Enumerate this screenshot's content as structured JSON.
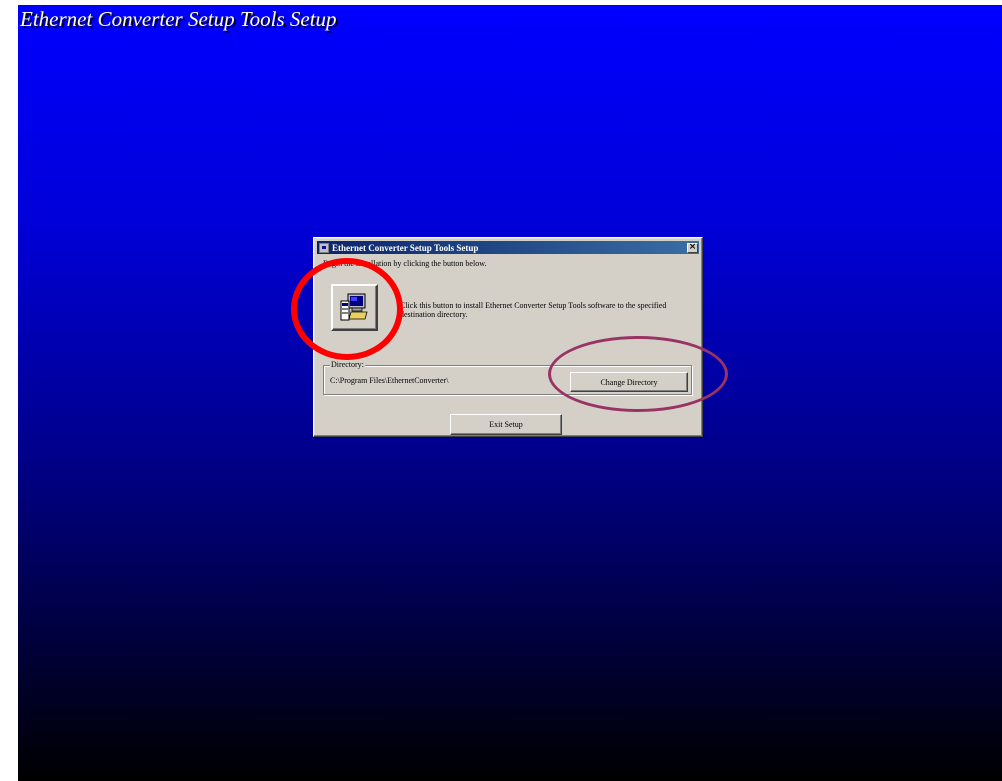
{
  "banner": {
    "title": "Ethernet Converter Setup Tools Setup"
  },
  "dialog": {
    "title": "Ethernet Converter Setup Tools Setup",
    "close_label": "×",
    "instruction": "Begin the installation by clicking the button below.",
    "install_button_icon": "computer-install-icon",
    "install_description": "Click this button to install Ethernet Converter Setup Tools software to the specified destination directory.",
    "directory_group_label": "Directory:",
    "directory_path": "C:\\Program Files\\EthernetConverter\\",
    "change_directory_label": "Change Directory",
    "exit_label": "Exit Setup"
  },
  "annotations": {
    "install_highlight_color": "#ff0000",
    "change_directory_highlight_color": "#993366"
  },
  "colors": {
    "gradient_top": "#0000ff",
    "gradient_bottom": "#000000",
    "dialog_face": "#d4d0c8",
    "titlebar_start": "#0a246a",
    "titlebar_end": "#3a6ea5"
  }
}
